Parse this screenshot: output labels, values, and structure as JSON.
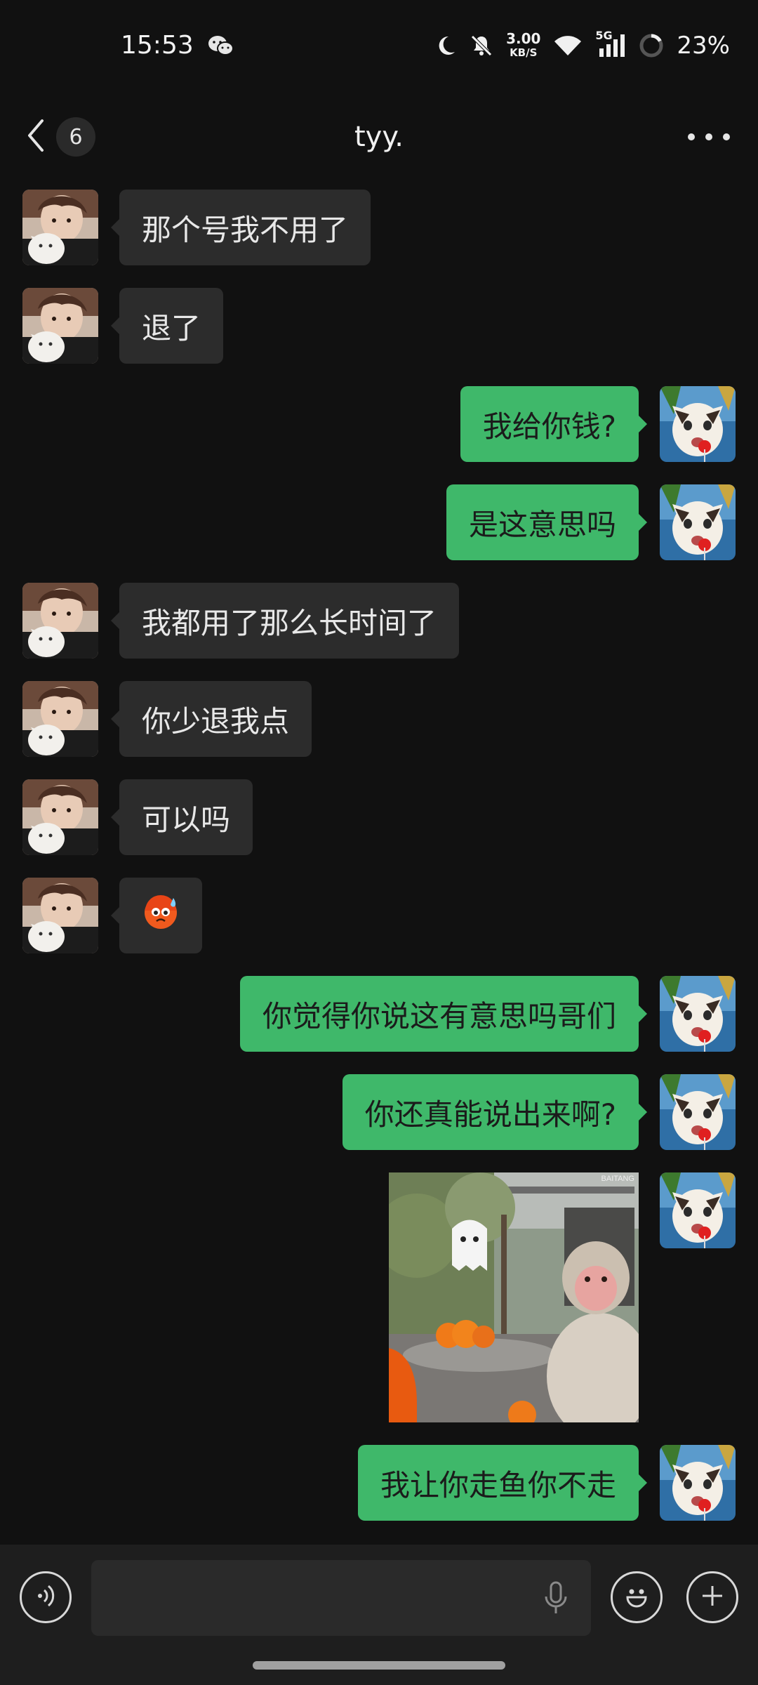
{
  "status_bar": {
    "time": "15:53",
    "net_speed_value": "3.00",
    "net_speed_unit": "KB/S",
    "network": "5G",
    "battery": "23%",
    "icons": [
      "wechat-icon",
      "moon-icon",
      "mute-icon",
      "wifi-icon",
      "signal-icon",
      "battery-icon"
    ]
  },
  "header": {
    "unread_count": "6",
    "title": "tyy.",
    "icons": [
      "back-icon",
      "more-icon"
    ]
  },
  "messages": [
    {
      "side": "in",
      "text": "那个号我不用了"
    },
    {
      "side": "in",
      "text": "退了"
    },
    {
      "side": "out",
      "text": "我给你钱?"
    },
    {
      "side": "out",
      "text": "是这意思吗"
    },
    {
      "side": "in",
      "text": "我都用了那么长时间了"
    },
    {
      "side": "in",
      "text": "你少退我点"
    },
    {
      "side": "in",
      "text": "可以吗"
    },
    {
      "side": "in",
      "text": "",
      "emoji": "cold-sweat-emoji"
    },
    {
      "side": "out",
      "text": "你觉得你说这有意思吗哥们"
    },
    {
      "side": "out",
      "text": "你还真能说出来啊?"
    },
    {
      "side": "out",
      "type": "image",
      "image": "monkey-photo",
      "watermark": "BAITANG"
    },
    {
      "side": "out",
      "text": "我让你走鱼你不走"
    }
  ],
  "input_bar": {
    "placeholder": "",
    "icons": [
      "voice-icon",
      "mic-icon",
      "emoji-icon",
      "plus-icon"
    ]
  },
  "colors": {
    "background": "#111111",
    "incoming_bubble": "#2c2c2c",
    "outgoing_bubble": "#3fb86a"
  }
}
